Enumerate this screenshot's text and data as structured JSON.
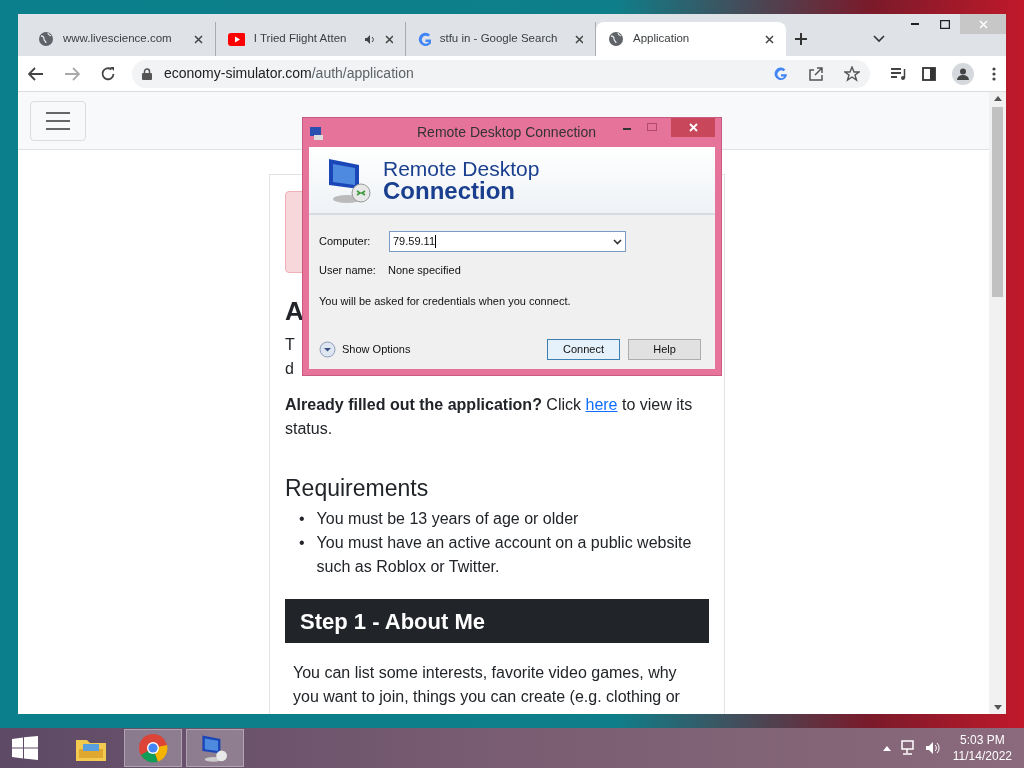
{
  "browser": {
    "tabs": [
      {
        "title": "www.livescience.com",
        "audio": false,
        "selected": false
      },
      {
        "title": "I Tried Flight Atten",
        "audio": true,
        "selected": false
      },
      {
        "title": "stfu in - Google Search",
        "audio": false,
        "selected": false
      },
      {
        "title": "Application",
        "audio": false,
        "selected": true
      }
    ],
    "url_host": "economy-simulator.com",
    "url_path": "/auth/application"
  },
  "page": {
    "heading_fragment": "A",
    "intro_fragments": [
      "T",
      "d"
    ],
    "status_line": "**Already filled out the application?** Click ",
    "status_link": "here",
    "status_rest": " to view its status.",
    "requirements_title": "Requirements",
    "requirements": [
      {
        "bullet": "•",
        "text": "You must be 13 years of age or older"
      },
      {
        "bullet": "•",
        "text": "You must have an active account on a public website such as Roblox or Twitter."
      }
    ],
    "step_title": "Step 1 - About Me",
    "step_text": "You can list some interests, favorite video games, why you want to join, things you can create (e.g. clothing or"
  },
  "dialog": {
    "title": "Remote Desktop Connection",
    "banner_line1": "Remote Desktop",
    "banner_line2": "Connection",
    "computer_label": "Computer:",
    "computer_value": "79.59.11",
    "user_label": "User name:",
    "user_value": "None specified",
    "note": "You will be asked for credentials when you connect.",
    "options": "Show Options",
    "buttons": [
      "Connect",
      "Help"
    ]
  },
  "taskbar": {
    "apps": [
      {
        "kind": "explorer",
        "selected": false
      },
      {
        "kind": "chrome",
        "selected": true
      },
      {
        "kind": "rdp",
        "selected": true
      }
    ],
    "time": "5:03 PM",
    "date": "11/14/2022"
  }
}
